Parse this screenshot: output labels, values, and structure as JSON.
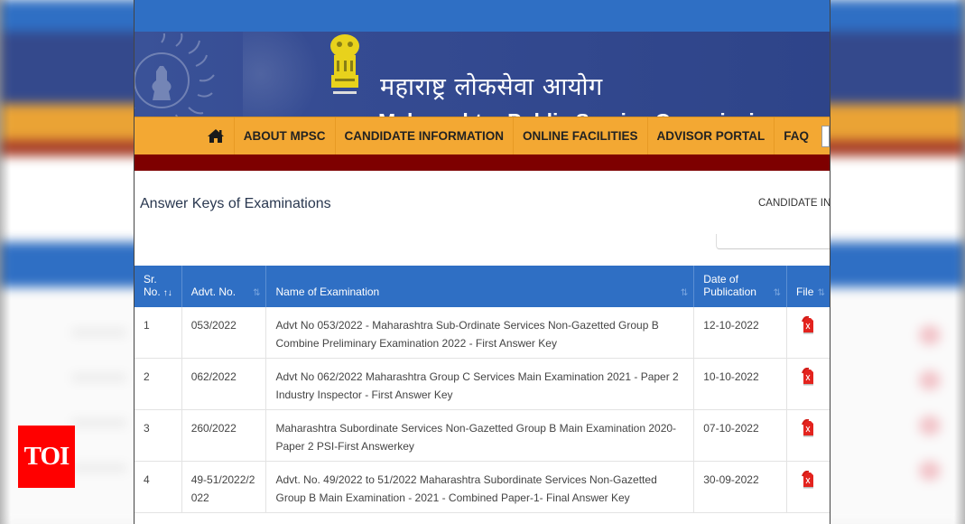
{
  "header": {
    "title_marathi": "महाराष्ट्र लोकसेवा आयोग",
    "title_english": "Maharashtra Public Service Commission"
  },
  "nav": {
    "items": [
      {
        "label": "ABOUT MPSC"
      },
      {
        "label": "CANDIDATE INFORMATION"
      },
      {
        "label": "ONLINE FACILITIES"
      },
      {
        "label": "ADVISOR PORTAL"
      },
      {
        "label": "FAQ"
      }
    ],
    "home_icon": "home-icon"
  },
  "page": {
    "title": "Answer Keys of Examinations",
    "breadcrumb": "CANDIDATE INF"
  },
  "table": {
    "columns": [
      {
        "line1": "Sr.",
        "line2": "No."
      },
      {
        "line1": "",
        "line2": "Advt. No."
      },
      {
        "line1": "",
        "line2": "Name of Examination"
      },
      {
        "line1": "Date of",
        "line2": "Publication"
      },
      {
        "line1": "",
        "line2": "File"
      }
    ],
    "sort_icon": "⇅",
    "sort_active_icon": "↑↓",
    "rows": [
      {
        "sr": "1",
        "advt": "053/2022",
        "name": "Advt No 053/2022 - Maharashtra Sub-Ordinate Services Non-Gazetted Group B Combine Preliminary Examination 2022 - First Answer Key",
        "date": "12-10-2022",
        "file_icon": "pdf-icon"
      },
      {
        "sr": "2",
        "advt": "062/2022",
        "name": "Advt No 062/2022 Maharashtra Group C Services Main Examination 2021 - Paper 2 Industry Inspector - First Answer Key",
        "date": "10-10-2022",
        "file_icon": "pdf-icon"
      },
      {
        "sr": "3",
        "advt": "260/2022",
        "name": "Maharashtra Subordinate Services Non-Gazetted Group B Main Examination 2020-Paper 2 PSI-First Answerkey",
        "date": "07-10-2022",
        "file_icon": "pdf-icon"
      },
      {
        "sr": "4",
        "advt": "49-51/2022/2022",
        "name": "Advt. No. 49/2022 to 51/2022 Maharashtra Subordinate Services Non-Gazetted Group B Main Examination - 2021 - Combined Paper-1- Final Answer Key",
        "date": "30-09-2022",
        "file_icon": "pdf-icon"
      }
    ]
  },
  "watermark": {
    "label": "TOI"
  },
  "colors": {
    "header_blue": "#2f6fc4",
    "banner_navy": "#354b92",
    "nav_orange": "#f3a833",
    "red_bar": "#7e0000",
    "toi_red": "#ff0000"
  }
}
